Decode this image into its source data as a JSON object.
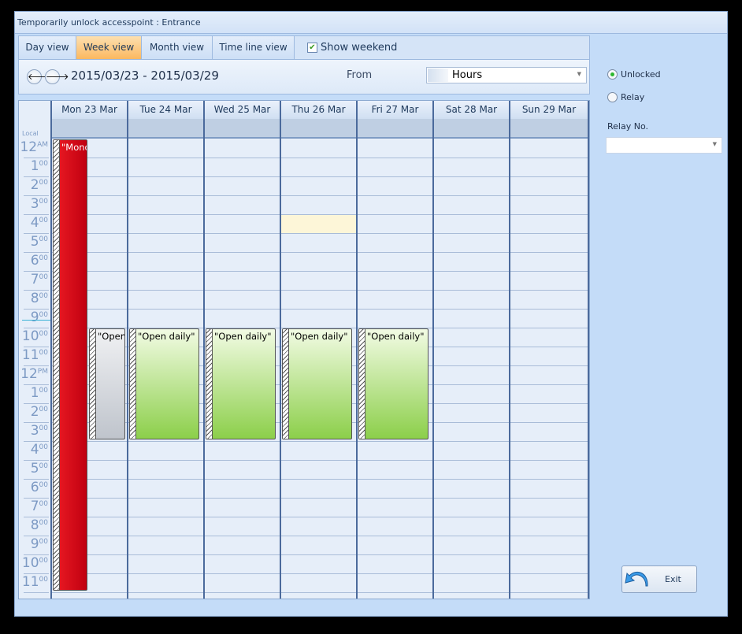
{
  "window": {
    "title": "Temporarily unlock accesspoint : Entrance"
  },
  "tabs": [
    {
      "label": "Day view",
      "active": false
    },
    {
      "label": "Week view",
      "active": true
    },
    {
      "label": "Month view",
      "active": false
    },
    {
      "label": "Time line view",
      "active": false
    }
  ],
  "show_weekend": {
    "label": "Show weekend",
    "checked": true
  },
  "nav": {
    "range": "2015/03/23 - 2015/03/29",
    "from_label": "From",
    "scale_value": "Hours"
  },
  "calendar": {
    "timezone_label": "Local",
    "days": [
      "Mon 23 Mar",
      "Tue 24 Mar",
      "Wed 25 Mar",
      "Thu 26 Mar",
      "Fri 27 Mar",
      "Sat 28 Mar",
      "Sun 29 Mar"
    ],
    "hours": [
      [
        "12",
        "AM"
      ],
      [
        "1",
        "00"
      ],
      [
        "2",
        "00"
      ],
      [
        "3",
        "00"
      ],
      [
        "4",
        "00"
      ],
      [
        "5",
        "00"
      ],
      [
        "6",
        "00"
      ],
      [
        "7",
        "00"
      ],
      [
        "8",
        "00"
      ],
      [
        "9",
        "00"
      ],
      [
        "10",
        "00"
      ],
      [
        "11",
        "00"
      ],
      [
        "12",
        "PM"
      ],
      [
        "1",
        "00"
      ],
      [
        "2",
        "00"
      ],
      [
        "3",
        "00"
      ],
      [
        "4",
        "00"
      ],
      [
        "5",
        "00"
      ],
      [
        "6",
        "00"
      ],
      [
        "7",
        "00"
      ],
      [
        "8",
        "00"
      ],
      [
        "9",
        "00"
      ],
      [
        "10",
        "00"
      ],
      [
        "11",
        "00"
      ]
    ],
    "selected_cell": {
      "day": 3,
      "hour": 4
    },
    "events": [
      {
        "label": "\"Monday\"",
        "day": 0,
        "start": 0,
        "end": 24,
        "lane": 0,
        "lanes": 2,
        "color": "#d8101a",
        "text_color": "#ffffff"
      },
      {
        "label": "\"Open daily\"",
        "day": 0,
        "start": 10,
        "end": 16,
        "lane": 1,
        "lanes": 2,
        "color": "#d4d8de",
        "text_color": "#000000"
      },
      {
        "label": "\"Open daily\"",
        "day": 1,
        "start": 10,
        "end": 16,
        "lane": 0,
        "lanes": 1,
        "color": "#b6df84",
        "text_color": "#000000"
      },
      {
        "label": "\"Open daily\"",
        "day": 2,
        "start": 10,
        "end": 16,
        "lane": 0,
        "lanes": 1,
        "color": "#b6df84",
        "text_color": "#000000"
      },
      {
        "label": "\"Open daily\"",
        "day": 3,
        "start": 10,
        "end": 16,
        "lane": 0,
        "lanes": 1,
        "color": "#b6df84",
        "text_color": "#000000"
      },
      {
        "label": "\"Open daily\"",
        "day": 4,
        "start": 10,
        "end": 16,
        "lane": 0,
        "lanes": 1,
        "color": "#b6df84",
        "text_color": "#000000"
      }
    ]
  },
  "options": {
    "unlocked_label": "Unlocked",
    "relay_label": "Relay",
    "selected": "Unlocked",
    "relay_no_label": "Relay No.",
    "relay_no_value": ""
  },
  "exit_label": "Exit"
}
